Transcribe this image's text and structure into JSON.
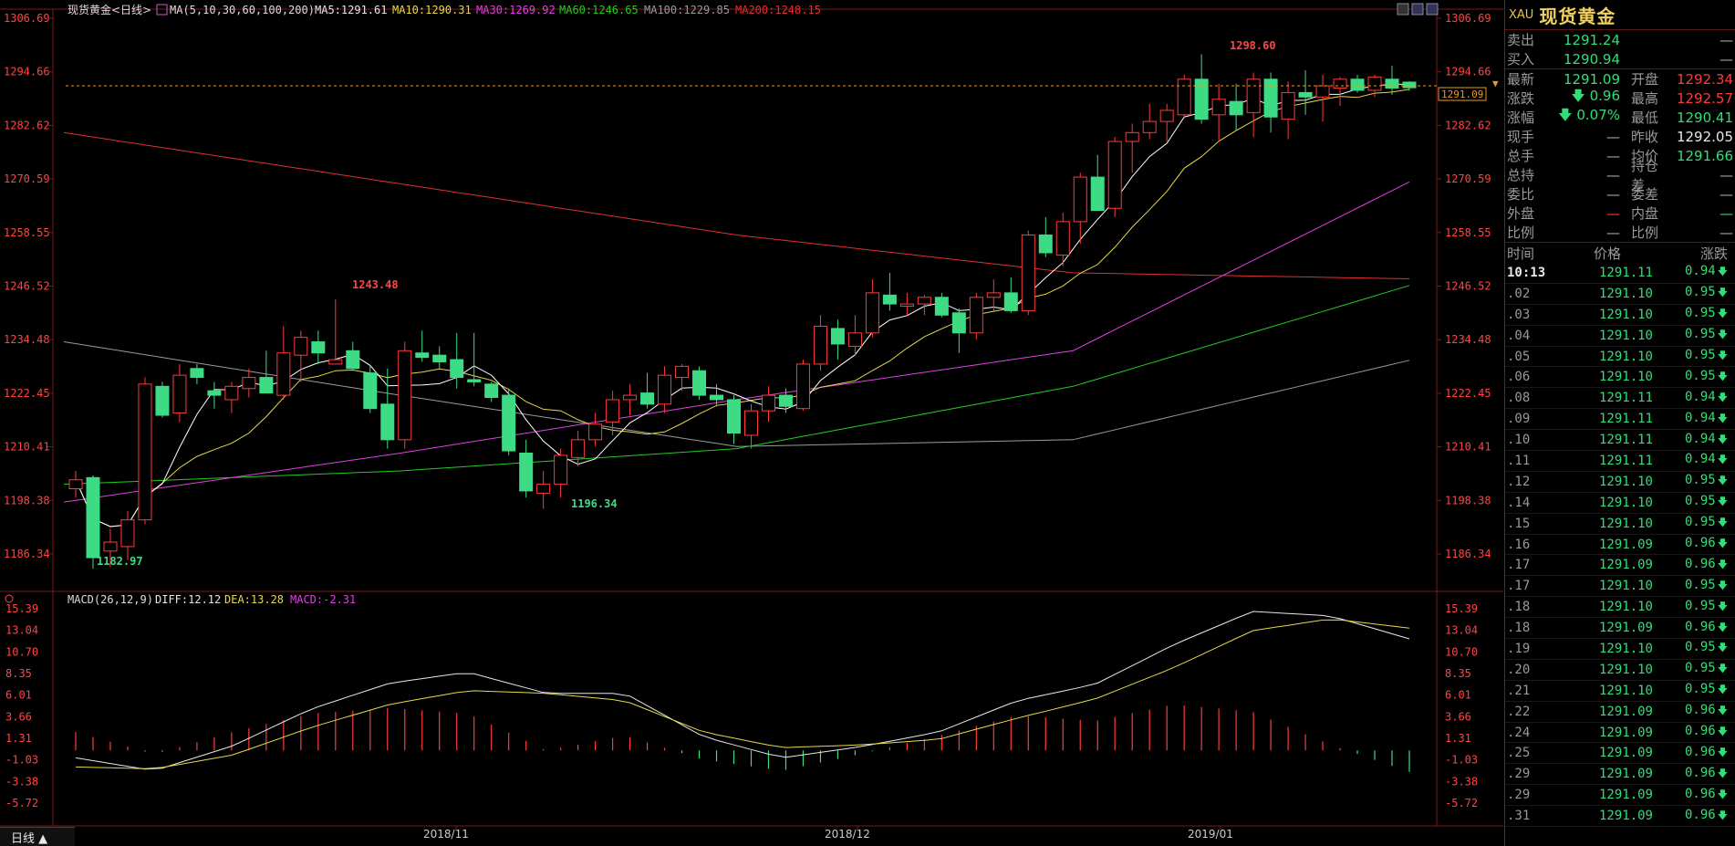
{
  "header": {
    "symbol_title": "现货黄金<日线>",
    "ma_params": "MA(5,10,30,60,100,200)",
    "ma5": "MA5:1291.61",
    "ma10": "MA10:1290.31",
    "ma30": "MA30:1269.92",
    "ma60": "MA60:1246.65",
    "ma100": "MA100:1229.85",
    "ma200": "MA200:1248.15"
  },
  "macd_header": {
    "params": "MACD(26,12,9)",
    "diff": "DIFF:12.12",
    "dea": "DEA:13.28",
    "macd": "MACD:-2.31"
  },
  "price_axis_left": [
    "1306.69",
    "1294.66",
    "1282.62",
    "1270.59",
    "1258.55",
    "1246.52",
    "1234.48",
    "1222.45",
    "1210.41",
    "1198.38",
    "1186.34"
  ],
  "price_axis_right": [
    "1306.69",
    "1294.66",
    "1282.62",
    "1270.59",
    "1258.55",
    "1246.52",
    "1234.48",
    "1222.45",
    "1210.41",
    "1198.38",
    "1186.34"
  ],
  "macd_axis": [
    "15.39",
    "13.04",
    "10.70",
    "8.35",
    "6.01",
    "3.66",
    "1.31",
    "-1.03",
    "-3.38",
    "-5.72"
  ],
  "current_price_tag": "1291.09",
  "annotations": {
    "high": "1298.60",
    "low1": "1182.97",
    "low2": "1196.34",
    "peak": "1243.48"
  },
  "date_labels": [
    "2018/11",
    "2018/12",
    "2019/01"
  ],
  "period_button": "日线 ▲",
  "colors": {
    "up": "#ff3b3b",
    "down": "#3ddc84",
    "ma5": "#ffffff",
    "ma10": "#e6d84a",
    "ma30": "#e040e0",
    "ma60": "#22cc22",
    "ma100": "#9a9a9a",
    "ma200": "#e03030"
  },
  "chart_data": {
    "type": "candlestick",
    "title": "现货黄金<日线>",
    "candles": [
      [
        1201.0,
        1205.0,
        1199.0,
        1203.0
      ],
      [
        1203.5,
        1204.0,
        1183.0,
        1185.5
      ],
      [
        1187.0,
        1192.0,
        1183.5,
        1189.0
      ],
      [
        1188.0,
        1196.0,
        1185.0,
        1194.0
      ],
      [
        1194.0,
        1226.0,
        1193.0,
        1224.5
      ],
      [
        1224.0,
        1225.0,
        1217.0,
        1217.5
      ],
      [
        1218.0,
        1229.0,
        1216.0,
        1226.5
      ],
      [
        1228.0,
        1229.0,
        1224.5,
        1226.0
      ],
      [
        1223.0,
        1225.0,
        1219.0,
        1222.0
      ],
      [
        1221.0,
        1225.0,
        1218.0,
        1224.0
      ],
      [
        1223.5,
        1228.0,
        1221.5,
        1226.0
      ],
      [
        1226.0,
        1232.0,
        1222.5,
        1222.5
      ],
      [
        1222.0,
        1237.5,
        1221.0,
        1231.5
      ],
      [
        1231.0,
        1236.5,
        1225.0,
        1235.0
      ],
      [
        1234.0,
        1236.5,
        1229.0,
        1231.5
      ],
      [
        1229.0,
        1243.5,
        1229.0,
        1230.0
      ],
      [
        1232.0,
        1234.0,
        1227.5,
        1228.0
      ],
      [
        1227.0,
        1228.5,
        1218.0,
        1219.0
      ],
      [
        1220.0,
        1228.0,
        1210.0,
        1212.0
      ],
      [
        1212.0,
        1234.0,
        1210.0,
        1232.0
      ],
      [
        1231.5,
        1236.5,
        1229.5,
        1230.5
      ],
      [
        1231.0,
        1233.0,
        1228.0,
        1229.5
      ],
      [
        1230.0,
        1236.0,
        1223.5,
        1226.0
      ],
      [
        1225.5,
        1236.0,
        1224.0,
        1225.0
      ],
      [
        1224.5,
        1225.0,
        1220.5,
        1221.5
      ],
      [
        1222.0,
        1223.5,
        1208.5,
        1209.5
      ],
      [
        1209.0,
        1212.0,
        1199.0,
        1200.5
      ],
      [
        1200.0,
        1205.0,
        1196.5,
        1202.0
      ],
      [
        1202.0,
        1210.0,
        1199.0,
        1208.5
      ],
      [
        1208.0,
        1214.0,
        1206.0,
        1212.0
      ],
      [
        1212.0,
        1218.0,
        1210.5,
        1215.5
      ],
      [
        1216.0,
        1223.0,
        1213.0,
        1221.0
      ],
      [
        1221.0,
        1224.5,
        1217.5,
        1222.0
      ],
      [
        1222.5,
        1227.0,
        1219.0,
        1220.0
      ],
      [
        1220.0,
        1228.5,
        1218.0,
        1226.5
      ],
      [
        1226.0,
        1229.0,
        1223.0,
        1228.5
      ],
      [
        1227.5,
        1228.5,
        1221.0,
        1222.0
      ],
      [
        1222.0,
        1224.5,
        1219.5,
        1221.0
      ],
      [
        1221.0,
        1222.0,
        1211.0,
        1213.5
      ],
      [
        1213.0,
        1220.0,
        1210.0,
        1218.5
      ],
      [
        1218.5,
        1224.0,
        1216.0,
        1222.0
      ],
      [
        1222.0,
        1223.5,
        1218.0,
        1219.5
      ],
      [
        1219.0,
        1230.0,
        1218.5,
        1229.0
      ],
      [
        1229.0,
        1240.0,
        1227.5,
        1237.5
      ],
      [
        1237.0,
        1239.0,
        1230.0,
        1233.5
      ],
      [
        1233.0,
        1240.0,
        1231.0,
        1236.0
      ],
      [
        1236.0,
        1248.0,
        1235.0,
        1245.0
      ],
      [
        1244.5,
        1249.5,
        1241.0,
        1242.5
      ],
      [
        1242.0,
        1245.0,
        1240.0,
        1242.5
      ],
      [
        1242.5,
        1244.5,
        1240.0,
        1244.0
      ],
      [
        1244.0,
        1245.0,
        1239.5,
        1240.0
      ],
      [
        1240.5,
        1241.5,
        1231.5,
        1236.0
      ],
      [
        1236.0,
        1245.0,
        1234.5,
        1244.0
      ],
      [
        1244.0,
        1248.0,
        1241.0,
        1245.0
      ],
      [
        1245.0,
        1248.5,
        1240.5,
        1241.0
      ],
      [
        1241.0,
        1259.0,
        1240.0,
        1258.0
      ],
      [
        1258.0,
        1262.0,
        1253.0,
        1254.0
      ],
      [
        1253.5,
        1263.0,
        1251.0,
        1261.0
      ],
      [
        1261.0,
        1272.0,
        1256.0,
        1271.0
      ],
      [
        1271.0,
        1276.0,
        1263.5,
        1263.5
      ],
      [
        1264.0,
        1280.0,
        1262.0,
        1279.0
      ],
      [
        1279.0,
        1283.0,
        1272.0,
        1281.0
      ],
      [
        1281.0,
        1287.5,
        1279.5,
        1283.5
      ],
      [
        1283.5,
        1287.5,
        1279.0,
        1286.0
      ],
      [
        1285.0,
        1294.0,
        1284.5,
        1293.0
      ],
      [
        1293.0,
        1298.6,
        1283.0,
        1284.0
      ],
      [
        1285.0,
        1292.0,
        1279.0,
        1288.5
      ],
      [
        1288.0,
        1292.0,
        1281.5,
        1285.0
      ],
      [
        1285.5,
        1294.5,
        1280.0,
        1293.0
      ],
      [
        1293.0,
        1294.5,
        1281.0,
        1284.5
      ],
      [
        1284.0,
        1292.5,
        1279.5,
        1290.0
      ],
      [
        1290.0,
        1295.0,
        1285.0,
        1289.0
      ],
      [
        1289.0,
        1294.0,
        1283.5,
        1291.5
      ],
      [
        1291.0,
        1293.5,
        1287.0,
        1293.0
      ],
      [
        1293.0,
        1294.0,
        1290.0,
        1290.5
      ],
      [
        1290.5,
        1294.0,
        1289.0,
        1293.5
      ],
      [
        1293.0,
        1296.0,
        1289.5,
        1291.0
      ],
      [
        1292.34,
        1292.57,
        1290.41,
        1291.09
      ]
    ],
    "ma_lines": {
      "MA200": [
        1281,
        1269.5,
        1258,
        1249.5,
        1248.15
      ],
      "MA100": [
        1234,
        1222,
        1210.5,
        1212,
        1229.85
      ],
      "MA60": [
        1202,
        1205,
        1210,
        1224,
        1246.65
      ],
      "MA30": [
        1198,
        1209,
        1221,
        1232,
        1269.92
      ]
    },
    "macd": {
      "diff": [
        -0.8,
        -2.2,
        0.5,
        4.5,
        7.3,
        8.5,
        6.2,
        6.2,
        1.5,
        -0.8,
        0.4,
        2.0,
        5.4,
        7.2,
        11.5,
        15.1,
        14.6,
        12.12
      ],
      "dea": [
        -1.8,
        -2.0,
        -0.5,
        2.5,
        5.0,
        6.5,
        6.2,
        5.4,
        2.0,
        0.3,
        0.6,
        1.2,
        3.5,
        5.6,
        9.0,
        13.0,
        14.3,
        13.28
      ]
    },
    "ylim": [
      1180,
      1310
    ],
    "x_labels": [
      "2018/11",
      "2018/12",
      "2019/01"
    ]
  },
  "quote": {
    "code": "XAU",
    "name": "现货黄金",
    "rows": [
      {
        "l1": "卖出",
        "v1": "1291.24",
        "c1": "green",
        "l2": "",
        "v2": "—",
        "c2": "grey"
      },
      {
        "l1": "买入",
        "v1": "1290.94",
        "c1": "green",
        "l2": "",
        "v2": "—",
        "c2": "grey"
      },
      {
        "l1": "最新",
        "v1": "1291.09",
        "c1": "green",
        "l2": "开盘",
        "v2": "1292.34",
        "c2": "red"
      },
      {
        "l1": "涨跌",
        "v1": "🡇 0.96",
        "c1": "green",
        "l2": "最高",
        "v2": "1292.57",
        "c2": "red"
      },
      {
        "l1": "涨幅",
        "v1": "🡇 0.07%",
        "c1": "green",
        "l2": "最低",
        "v2": "1290.41",
        "c2": "green"
      },
      {
        "l1": "现手",
        "v1": "—",
        "c1": "grey",
        "l2": "昨收",
        "v2": "1292.05",
        "c2": "white"
      },
      {
        "l1": "总手",
        "v1": "—",
        "c1": "grey",
        "l2": "均价",
        "v2": "1291.66",
        "c2": "green"
      },
      {
        "l1": "总持",
        "v1": "—",
        "c1": "grey",
        "l2": "持仓差",
        "v2": "—",
        "c2": "grey"
      },
      {
        "l1": "委比",
        "v1": "—",
        "c1": "grey",
        "l2": "委差",
        "v2": "—",
        "c2": "grey"
      },
      {
        "l1": "外盘",
        "v1": "—",
        "c1": "red",
        "l2": "内盘",
        "v2": "—",
        "c2": "green"
      },
      {
        "l1": "比例",
        "v1": "—",
        "c1": "grey",
        "l2": "比例",
        "v2": "—",
        "c2": "grey"
      }
    ]
  },
  "ticks_header": {
    "time": "时间",
    "price": "价格",
    "change": "涨跌"
  },
  "ticks": [
    {
      "t": "10:13",
      "p": "1291.11",
      "c": "0.94"
    },
    {
      "t": ".02",
      "p": "1291.10",
      "c": "0.95"
    },
    {
      "t": ".03",
      "p": "1291.10",
      "c": "0.95"
    },
    {
      "t": ".04",
      "p": "1291.10",
      "c": "0.95"
    },
    {
      "t": ".05",
      "p": "1291.10",
      "c": "0.95"
    },
    {
      "t": ".06",
      "p": "1291.10",
      "c": "0.95"
    },
    {
      "t": ".08",
      "p": "1291.11",
      "c": "0.94"
    },
    {
      "t": ".09",
      "p": "1291.11",
      "c": "0.94"
    },
    {
      "t": ".10",
      "p": "1291.11",
      "c": "0.94"
    },
    {
      "t": ".11",
      "p": "1291.11",
      "c": "0.94"
    },
    {
      "t": ".12",
      "p": "1291.10",
      "c": "0.95"
    },
    {
      "t": ".14",
      "p": "1291.10",
      "c": "0.95"
    },
    {
      "t": ".15",
      "p": "1291.10",
      "c": "0.95"
    },
    {
      "t": ".16",
      "p": "1291.09",
      "c": "0.96"
    },
    {
      "t": ".17",
      "p": "1291.09",
      "c": "0.96"
    },
    {
      "t": ".17",
      "p": "1291.10",
      "c": "0.95"
    },
    {
      "t": ".18",
      "p": "1291.10",
      "c": "0.95"
    },
    {
      "t": ".18",
      "p": "1291.09",
      "c": "0.96"
    },
    {
      "t": ".19",
      "p": "1291.10",
      "c": "0.95"
    },
    {
      "t": ".20",
      "p": "1291.10",
      "c": "0.95"
    },
    {
      "t": ".21",
      "p": "1291.10",
      "c": "0.95"
    },
    {
      "t": ".22",
      "p": "1291.09",
      "c": "0.96"
    },
    {
      "t": ".24",
      "p": "1291.09",
      "c": "0.96"
    },
    {
      "t": ".25",
      "p": "1291.09",
      "c": "0.96"
    },
    {
      "t": ".29",
      "p": "1291.09",
      "c": "0.96"
    },
    {
      "t": ".29",
      "p": "1291.09",
      "c": "0.96"
    },
    {
      "t": ".31",
      "p": "1291.09",
      "c": "0.96"
    }
  ]
}
